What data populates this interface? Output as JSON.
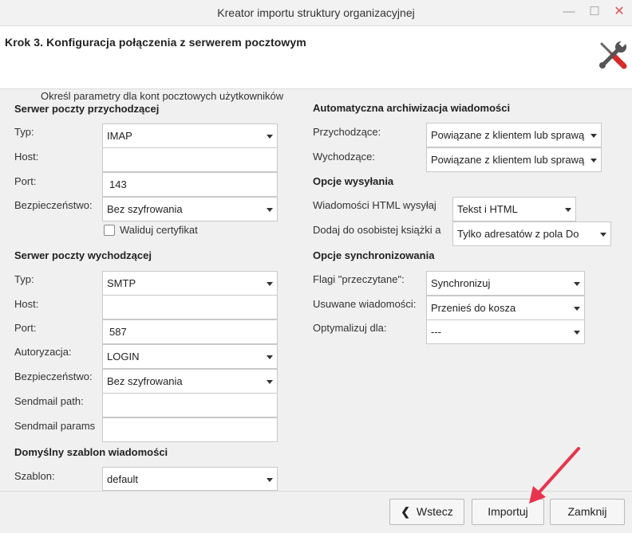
{
  "window": {
    "title": "Kreator importu struktury organizacyjnej",
    "controls": {
      "minimize": "—",
      "maximize": "☐",
      "close": "✕"
    }
  },
  "header": {
    "step": "Krok 3. Konfiguracja połączenia z serwerem pocztowym",
    "icon": "tools-icon"
  },
  "subtitle": "Określ parametry dla kont pocztowych użytkowników",
  "incoming": {
    "section": "Serwer poczty przychodzącej",
    "type_label": "Typ:",
    "type_value": "IMAP",
    "host_label": "Host:",
    "host_value": "",
    "port_label": "Port:",
    "port_value": "143",
    "security_label": "Bezpieczeństwo:",
    "security_value": "Bez szyfrowania",
    "validate_cert_label": "Waliduj certyfikat",
    "validate_cert_checked": false
  },
  "outgoing": {
    "section": "Serwer poczty wychodzącej",
    "type_label": "Typ:",
    "type_value": "SMTP",
    "host_label": "Host:",
    "host_value": "",
    "port_label": "Port:",
    "port_value": "587",
    "auth_label": "Autoryzacja:",
    "auth_value": "LOGIN",
    "security_label": "Bezpieczeństwo:",
    "security_value": "Bez szyfrowania",
    "sendmail_path_label": "Sendmail path:",
    "sendmail_path_value": "",
    "sendmail_params_label": "Sendmail params",
    "sendmail_params_value": ""
  },
  "template": {
    "section": "Domyślny szablon wiadomości",
    "label": "Szablon:",
    "value": "default"
  },
  "archive": {
    "section": "Automatyczna archiwizacja wiadomości",
    "incoming_label": "Przychodzące:",
    "incoming_value": "Powiązane z klientem lub sprawą",
    "outgoing_label": "Wychodzące:",
    "outgoing_value": "Powiązane z klientem lub sprawą"
  },
  "sending": {
    "section": "Opcje wysyłania",
    "html_label": "Wiadomości HTML wysyłaj",
    "html_value": "Tekst i HTML",
    "addressbook_label": "Dodaj do osobistej książki a",
    "addressbook_value": "Tylko adresatów z pola Do"
  },
  "sync": {
    "section": "Opcje synchronizowania",
    "read_flags_label": "Flagi \"przeczytane\":",
    "read_flags_value": "Synchronizuj",
    "deleted_label": "Usuwane wiadomości:",
    "deleted_value": "Przenieś do kosza",
    "optimize_label": "Optymalizuj dla:",
    "optimize_value": "---"
  },
  "buttons": {
    "back": "Wstecz",
    "import": "Importuj",
    "close": "Zamknij"
  },
  "colors": {
    "annotation_arrow": "#e8344e",
    "close_button": "#e25353",
    "tools_handle_red": "#d62b2b",
    "tools_metal": "#555555"
  }
}
